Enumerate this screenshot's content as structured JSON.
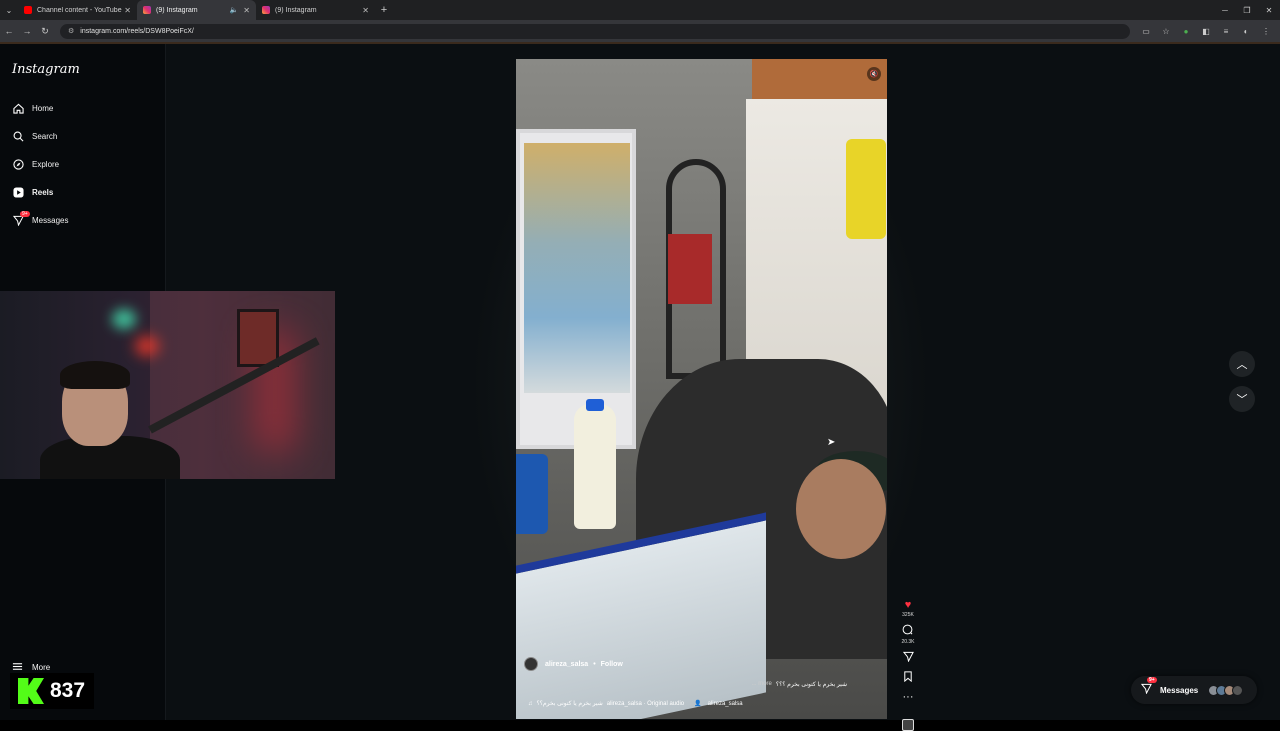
{
  "browser": {
    "tabs": [
      {
        "title": "Channel content - YouTube Stu",
        "icon": "youtube-icon",
        "active": false
      },
      {
        "title": "(9) Instagram",
        "icon": "instagram-icon",
        "active": true
      },
      {
        "title": "(9) Instagram",
        "icon": "instagram-icon",
        "active": false
      }
    ],
    "url": "instagram.com/reels/DSW8PoeiFcX/"
  },
  "sidebar": {
    "logo": "Instagram",
    "items": [
      {
        "label": "Home",
        "icon": "home-icon"
      },
      {
        "label": "Search",
        "icon": "search-icon"
      },
      {
        "label": "Explore",
        "icon": "explore-icon"
      },
      {
        "label": "Reels",
        "icon": "reels-icon"
      },
      {
        "label": "Messages",
        "icon": "messages-icon",
        "badge": "9+"
      }
    ],
    "more_label": "More"
  },
  "overlay": {
    "viewer_count": "837"
  },
  "reel": {
    "username": "alireza_salsa",
    "follow_label": "Follow",
    "caption": "شیر بخرم یا کتونی بخرم ؟؟؟",
    "more_label": "... more",
    "audio_text": "alireza_salsa · Original audio",
    "audio_title": "شیر بخرم یا کتونی بخرم؟؟",
    "tagged_user": "alireza_salsa",
    "likes": "325K",
    "comments": "20.3K"
  },
  "messages_pill": {
    "label": "Messages",
    "badge": "9+"
  },
  "colors": {
    "accent_red": "#ff3040",
    "kick_green": "#53fc18"
  }
}
